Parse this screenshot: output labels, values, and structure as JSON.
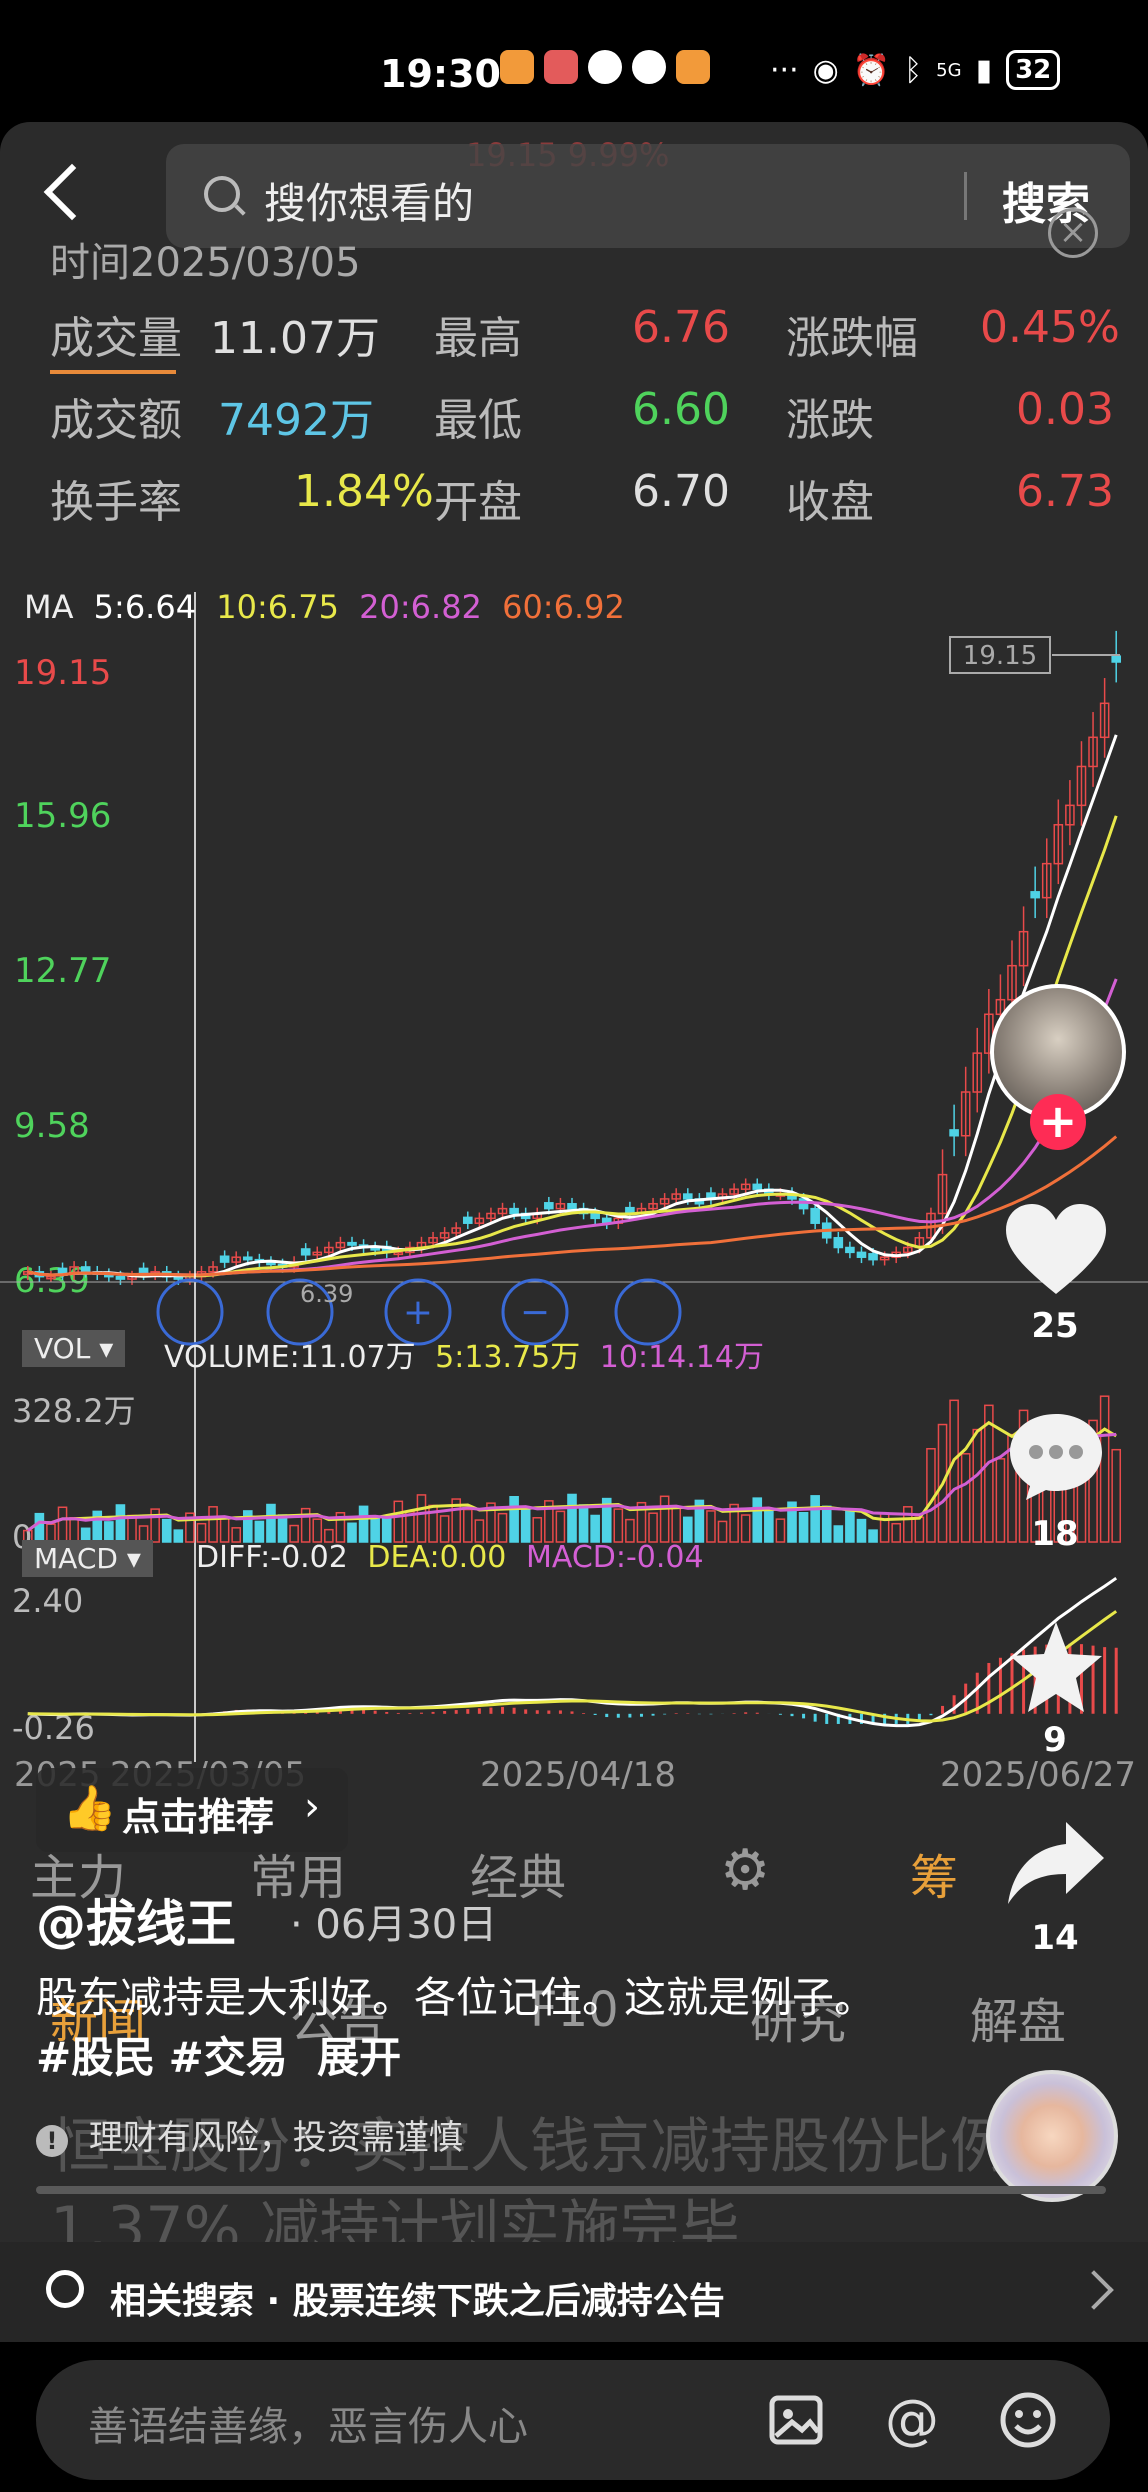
{
  "status_bar": {
    "time": "19:30",
    "network": "5G",
    "battery": "32"
  },
  "search": {
    "placeholder": "搜你想看的",
    "button_label": "搜索",
    "ghost_price": "19.15  9.99%"
  },
  "quote_info": {
    "date_label": "时间2025/03/05",
    "rows": [
      [
        {
          "label": "成交量",
          "value": "11.07万",
          "color": "#e0e0e0"
        },
        {
          "label": "最高",
          "value": "6.76",
          "color": "#e84a4a"
        },
        {
          "label": "涨跌幅",
          "value": "0.45%",
          "color": "#e84a4a"
        }
      ],
      [
        {
          "label": "成交额",
          "value": "7492万",
          "color": "#5ec6e6"
        },
        {
          "label": "最低",
          "value": "6.60",
          "color": "#4fd35c"
        },
        {
          "label": "涨跌",
          "value": "0.03",
          "color": "#e84a4a"
        }
      ],
      [
        {
          "label": "换手率",
          "value": "1.84%",
          "color": "#e8e84a"
        },
        {
          "label": "开盘",
          "value": "6.70",
          "color": "#e0e0e0"
        },
        {
          "label": "收盘",
          "value": "6.73",
          "color": "#e84a4a"
        }
      ]
    ]
  },
  "ma_legend": {
    "ma": "MA",
    "ma5": "5:6.64",
    "ma10": "10:6.75",
    "ma20": "20:6.82",
    "ma60": "60:6.92"
  },
  "volume_legend": {
    "tag": "VOL",
    "volume": "VOLUME:11.07万",
    "ma5": "5:13.75万",
    "ma10": "10:14.14万"
  },
  "macd_legend": {
    "tag": "MACD",
    "diff": "DIFF:-0.02",
    "dea": "DEA:0.00",
    "macd": "MACD:-0.04"
  },
  "chart_data": [
    {
      "type": "candlestick",
      "title": "",
      "y_axis_ticks": [
        "19.15",
        "15.96",
        "12.77",
        "9.58",
        "6.39"
      ],
      "ylim": [
        6.39,
        19.15
      ],
      "x": [
        "2025/03/05",
        "2025/04/18",
        "2025/06/27"
      ],
      "x_axis_labels": [
        "2025",
        "2025/03/05",
        "2025/04/18",
        "2025/06/27"
      ],
      "max_marker": "19.15",
      "min_marker": "6.39",
      "closes": [
        6.6,
        6.5,
        6.5,
        6.55,
        6.7,
        6.6,
        6.55,
        6.5,
        6.45,
        6.5,
        6.55,
        6.6,
        6.5,
        6.45,
        6.5,
        6.6,
        6.7,
        6.8,
        6.9,
        6.85,
        6.8,
        6.75,
        6.7,
        6.8,
        6.95,
        7.0,
        7.1,
        7.2,
        7.15,
        7.1,
        7.05,
        7.0,
        7.0,
        7.1,
        7.2,
        7.3,
        7.4,
        7.5,
        7.6,
        7.7,
        7.8,
        7.9,
        7.8,
        7.7,
        7.8,
        7.9,
        8.0,
        7.9,
        7.8,
        7.7,
        7.6,
        7.7,
        7.8,
        7.9,
        8.0,
        8.1,
        8.2,
        8.1,
        8.0,
        8.1,
        8.2,
        8.3,
        8.4,
        8.3,
        8.2,
        8.2,
        8.1,
        7.9,
        7.6,
        7.3,
        7.1,
        7.0,
        6.9,
        6.85,
        6.9,
        7.0,
        7.1,
        7.3,
        7.8,
        8.6,
        9.4,
        10.3,
        11.1,
        11.9,
        12.2,
        12.9,
        13.6,
        14.3,
        15.0,
        15.8,
        16.2,
        17.0,
        17.6,
        18.3,
        19.15
      ],
      "series_ma": [
        {
          "name": "MA5",
          "color": "#ffffff"
        },
        {
          "name": "MA10",
          "color": "#e8e84a"
        },
        {
          "name": "MA20",
          "color": "#d35fd3"
        },
        {
          "name": "MA60",
          "color": "#f0703a"
        }
      ]
    },
    {
      "type": "bar",
      "title": "",
      "y_axis_ticks": [
        "328.2万",
        "0"
      ],
      "ylim": [
        0,
        328.2
      ],
      "unit": "万"
    },
    {
      "type": "line",
      "title": "",
      "y_axis_ticks": [
        "2.40",
        "-0.26"
      ],
      "ylim": [
        -0.26,
        2.4
      ]
    }
  ],
  "tabs": {
    "row1": [
      "主力",
      "常用",
      "经典",
      "筹"
    ],
    "row2": [
      "新闻",
      "公告",
      "F10",
      "研究",
      "解盘"
    ]
  },
  "social": {
    "likes": "25",
    "comments": "18",
    "favorites": "9",
    "shares": "14"
  },
  "recommend": {
    "label": "点击推荐"
  },
  "post": {
    "author": "@拔线王",
    "date": "· 06月30日",
    "caption_text": "股东减持是大利好。各位记住。这就是例子。",
    "tag1": "#股民",
    "tag2": "#交易",
    "expand": "展开",
    "risk_notice": "理财有风险，投资需谨慎"
  },
  "ghost_headline": "恒宝股份：实控人钱京减持股份比例达1.37% 减持计划实施完毕",
  "related": {
    "label": "相关搜索 · 股票连续下跌之后减持公告"
  },
  "comment_box": {
    "placeholder": "善语结善缘，恶言伤人心"
  },
  "colors": {
    "up": "#e84a4a",
    "down": "#4fd3e6",
    "background": "#2b2b2b",
    "accent": "#fe2c55"
  }
}
